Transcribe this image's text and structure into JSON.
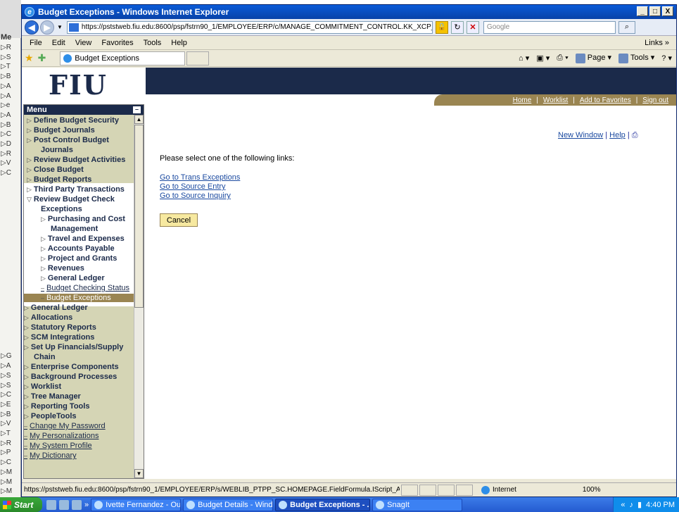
{
  "window": {
    "title": "Budget Exceptions - Windows Internet Explorer",
    "minimize": "_",
    "maximize": "□",
    "close": "X"
  },
  "address_bar": {
    "url": "https://pststweb.fiu.edu:8600/psp/fstrn90_1/EMPLOYEE/ERP/c/MANAGE_COMMITMENT_CONTROL.KK_XCP_BI",
    "search_placeholder": "Google"
  },
  "menubar": {
    "items": [
      "File",
      "Edit",
      "View",
      "Favorites",
      "Tools",
      "Help"
    ],
    "links": "Links »"
  },
  "favbar": {
    "tab_title": "Budget Exceptions",
    "tools": [
      "Page ▾",
      "Tools ▾"
    ]
  },
  "header": {
    "logo": "FIU",
    "links": [
      "Home",
      "Worklist",
      "Add to Favorites",
      "Sign out"
    ]
  },
  "menu": {
    "title": "Menu",
    "items": [
      {
        "label": "Define Budget Security",
        "tri": "▷"
      },
      {
        "label": "Budget Journals",
        "tri": "▷"
      },
      {
        "label": "Post Control Budget",
        "tri": "▷"
      },
      {
        "label": "Journals",
        "tri": ""
      },
      {
        "label": "Review Budget Activities",
        "tri": "▷"
      },
      {
        "label": "Close Budget",
        "tri": "▷"
      },
      {
        "label": "Budget Reports",
        "tri": "▷"
      },
      {
        "label": "Third Party Transactions",
        "tri": "▷"
      },
      {
        "label": "Review Budget Check",
        "tri": "▽"
      },
      {
        "label": "Exceptions",
        "tri": ""
      },
      {
        "label": "Purchasing and Cost",
        "tri": "▷"
      },
      {
        "label": "Management",
        "tri": ""
      },
      {
        "label": "Travel and Expenses",
        "tri": "▷"
      },
      {
        "label": "Accounts Payable",
        "tri": "▷"
      },
      {
        "label": "Project and Grants",
        "tri": "▷"
      },
      {
        "label": "Revenues",
        "tri": "▷"
      },
      {
        "label": "General Ledger",
        "tri": "▷"
      },
      {
        "label": "Budget Checking Status",
        "tri": "–"
      },
      {
        "label": "Budget Exceptions",
        "tri": "–"
      },
      {
        "label": "General Ledger",
        "tri": "▷"
      },
      {
        "label": "Allocations",
        "tri": "▷"
      },
      {
        "label": "Statutory Reports",
        "tri": "▷"
      },
      {
        "label": "SCM Integrations",
        "tri": "▷"
      },
      {
        "label": "Set Up Financials/Supply",
        "tri": "▷"
      },
      {
        "label": "Chain",
        "tri": ""
      },
      {
        "label": "Enterprise Components",
        "tri": "▷"
      },
      {
        "label": "Background Processes",
        "tri": "▷"
      },
      {
        "label": "Worklist",
        "tri": "▷"
      },
      {
        "label": "Tree Manager",
        "tri": "▷"
      },
      {
        "label": "Reporting Tools",
        "tri": "▷"
      },
      {
        "label": "PeopleTools",
        "tri": "▷"
      },
      {
        "label": "Change My Password",
        "tri": "–"
      },
      {
        "label": "My Personalizations",
        "tri": "–"
      },
      {
        "label": "My System Profile",
        "tri": "–"
      },
      {
        "label": "My Dictionary",
        "tri": "–"
      }
    ]
  },
  "main": {
    "new_window": "New Window",
    "help": "Help",
    "prompt": "Please select one of the following links:",
    "links": [
      "Go to Trans Exceptions",
      "Go to Source Entry",
      "Go to Source Inquiry"
    ],
    "cancel": "Cancel"
  },
  "status": {
    "url": "https://pststweb.fiu.edu:8600/psp/fstrn90_1/EMPLOYEE/ERP/s/WEBLIB_PTPP_SC.HOMEPAGE.FieldFormula.IScript_AppHF",
    "zone": "Internet",
    "zoom": "100%"
  },
  "taskbar": {
    "start": "Start",
    "tasks": [
      "Ivette Fernandez - Outlo...",
      "Budget Details - Window...",
      "Budget Exceptions - ...",
      "SnagIt"
    ],
    "clock": "4:40 PM"
  },
  "behind_window": {
    "label": "Me",
    "letters": [
      "R",
      "S",
      "T",
      "B",
      "A",
      "A",
      "e",
      "A",
      "B",
      "C",
      "D",
      "R",
      "V",
      "C",
      "",
      "",
      "",
      "",
      "",
      "",
      "",
      "",
      "",
      "",
      "",
      "",
      "",
      "",
      "",
      "",
      "",
      "",
      "G",
      "A",
      "S",
      "S",
      "C",
      "E",
      "B",
      "V",
      "T",
      "R",
      "P",
      "C",
      "M",
      "M",
      "M"
    ]
  }
}
